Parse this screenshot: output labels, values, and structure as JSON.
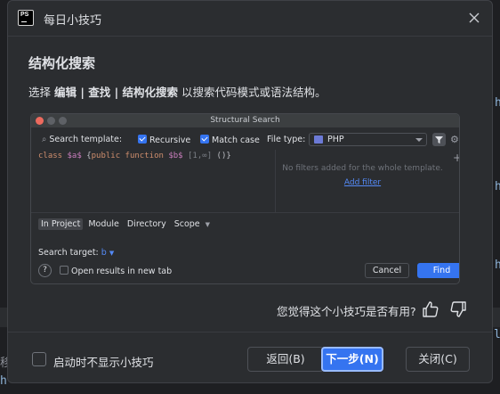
{
  "window": {
    "title": "每日小技巧",
    "app_logo_text": "PS"
  },
  "tip": {
    "heading": "结构化搜索",
    "desc_prefix": "选择 ",
    "desc_path": "编辑 | 查找 | 结构化搜索",
    "desc_suffix": " 以搜索代码模式或语法结构。"
  },
  "illustration": {
    "title": "Structural Search",
    "search_template_label": "Search template:",
    "recursive_label": "Recursive",
    "recursive_checked": true,
    "match_case_label": "Match case",
    "match_case_checked": true,
    "file_type_label": "File type:",
    "file_type_value": "PHP",
    "code": {
      "kw1": "class",
      "var1": "$a$",
      "brace_open": "{",
      "kw2": "public function",
      "var2": "$b$",
      "range": "[1,∞]",
      "tail": "()}"
    },
    "no_filters_text": "No filters added for the whole template.",
    "add_filter_link": "Add filter",
    "scope_tabs": [
      "In Project",
      "Module",
      "Directory",
      "Scope"
    ],
    "scope_selected": "In Project",
    "search_target_label": "Search target:",
    "search_target_value": "b",
    "help_glyph": "?",
    "open_results_label": "Open results in new tab",
    "cancel_label": "Cancel",
    "find_label": "Find"
  },
  "feedback": {
    "question": "您觉得这个小技巧是否有用?"
  },
  "footer": {
    "dont_show_label": "启动时不显示小技巧",
    "back_label": "返回(B)",
    "next_label": "下一步(N)",
    "close_label": "关闭(C)"
  },
  "colors": {
    "accent": "#3574f0",
    "dialog_bg": "#2b2d30",
    "text": "#dfe1e5"
  }
}
